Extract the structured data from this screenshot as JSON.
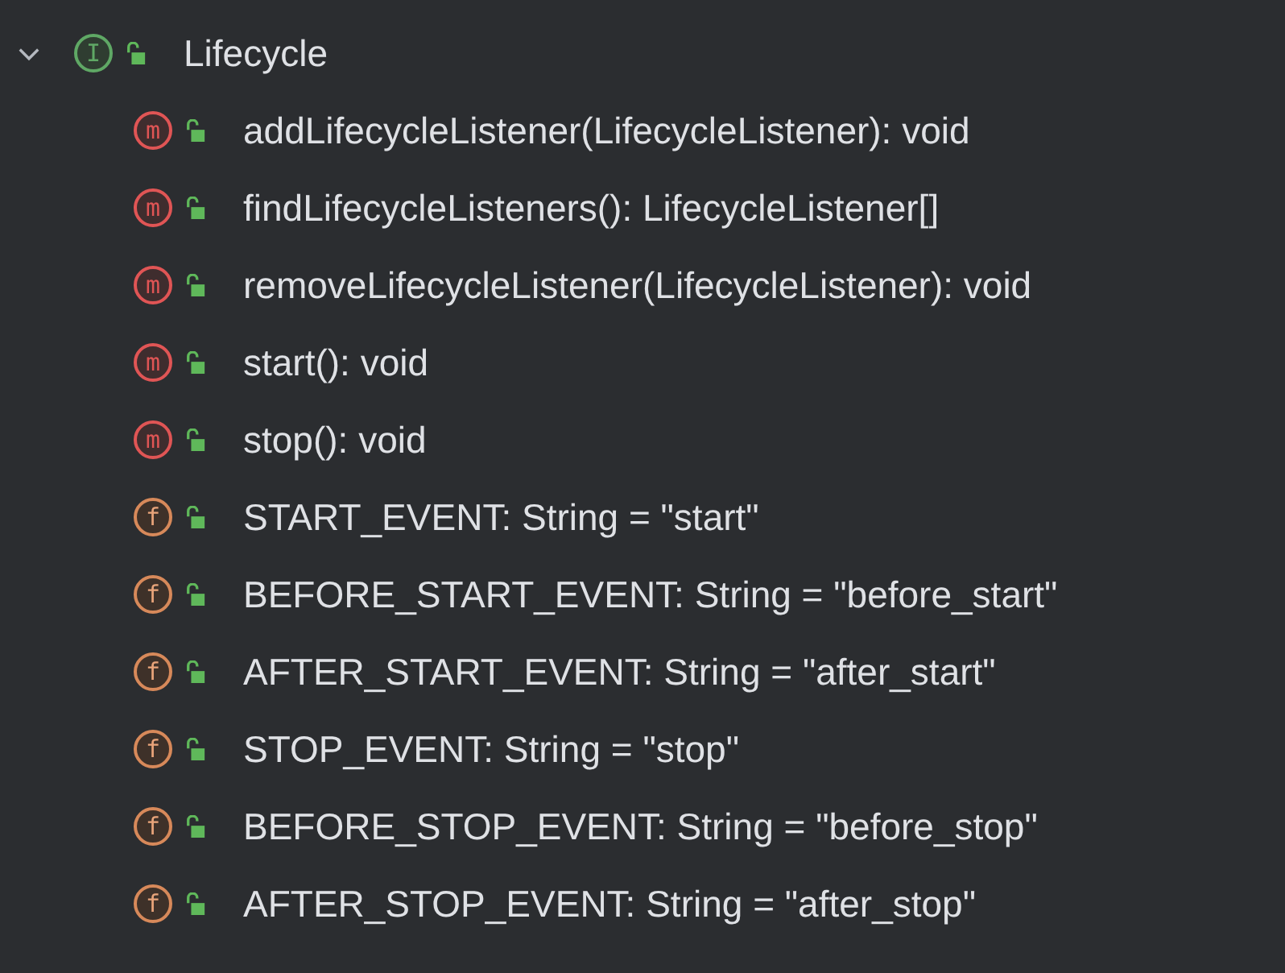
{
  "tree": [
    {
      "kind": "interface",
      "badge": "I",
      "label": "Lifecycle",
      "expanded": true,
      "children": [
        {
          "kind": "method",
          "badge": "m",
          "label": "addLifecycleListener(LifecycleListener): void"
        },
        {
          "kind": "method",
          "badge": "m",
          "label": "findLifecycleListeners(): LifecycleListener[]"
        },
        {
          "kind": "method",
          "badge": "m",
          "label": "removeLifecycleListener(LifecycleListener): void"
        },
        {
          "kind": "method",
          "badge": "m",
          "label": "start(): void"
        },
        {
          "kind": "method",
          "badge": "m",
          "label": "stop(): void"
        },
        {
          "kind": "field",
          "badge": "f",
          "label": "START_EVENT: String = \"start\""
        },
        {
          "kind": "field",
          "badge": "f",
          "label": "BEFORE_START_EVENT: String = \"before_start\""
        },
        {
          "kind": "field",
          "badge": "f",
          "label": "AFTER_START_EVENT: String = \"after_start\""
        },
        {
          "kind": "field",
          "badge": "f",
          "label": "STOP_EVENT: String = \"stop\""
        },
        {
          "kind": "field",
          "badge": "f",
          "label": "BEFORE_STOP_EVENT: String = \"before_stop\""
        },
        {
          "kind": "field",
          "badge": "f",
          "label": "AFTER_STOP_EVENT: String = \"after_stop\""
        }
      ]
    }
  ]
}
